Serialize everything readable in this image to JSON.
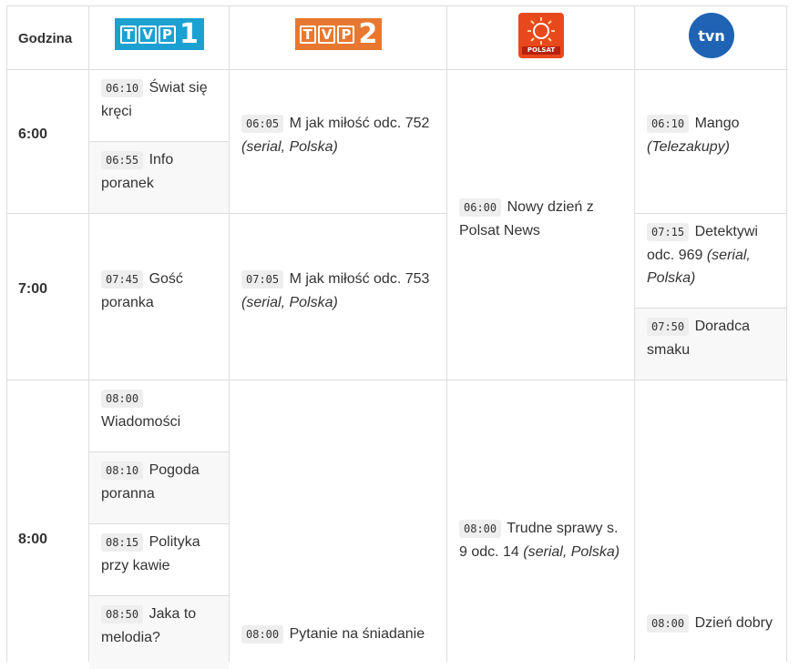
{
  "header": {
    "hour_label": "Godzina",
    "channels": [
      {
        "name": "TVP 1",
        "icon": "tvp1-logo",
        "letters": [
          "T",
          "V",
          "P"
        ],
        "number": "1",
        "color": "#1ba1d1"
      },
      {
        "name": "TVP 2",
        "icon": "tvp2-logo",
        "letters": [
          "T",
          "V",
          "P"
        ],
        "number": "2",
        "color": "#e8782f"
      },
      {
        "name": "POLSAT",
        "icon": "polsat-logo",
        "caption": "POLSAT",
        "color": "#e8491c"
      },
      {
        "name": "tvn",
        "icon": "tvn-logo",
        "caption": "tvn",
        "color": "#1f63b4"
      }
    ]
  },
  "hours": [
    "6:00",
    "7:00",
    "8:00"
  ],
  "programs": {
    "tvp1": [
      {
        "time": "06:10",
        "title": "Świat się kręci"
      },
      {
        "time": "06:55",
        "title": "Info poranek"
      },
      {
        "time": "07:45",
        "title": "Gość poranka"
      },
      {
        "time": "08:00",
        "title": "Wiadomości"
      },
      {
        "time": "08:10",
        "title": "Pogoda poranna"
      },
      {
        "time": "08:15",
        "title": "Polityka przy kawie"
      },
      {
        "time": "08:50",
        "title": "Jaka to melodia?"
      }
    ],
    "tvp2": [
      {
        "time": "06:05",
        "title": "M jak miłość odc. 752",
        "desc": "(serial, Polska)"
      },
      {
        "time": "07:05",
        "title": "M jak miłość odc. 753",
        "desc": "(serial, Polska)"
      },
      {
        "time": "08:00",
        "title": "Pytanie na śniadanie"
      }
    ],
    "polsat": [
      {
        "time": "06:00",
        "title": "Nowy dzień z Polsat News"
      },
      {
        "time": "08:00",
        "title": "Trudne sprawy s. 9 odc. 14",
        "desc": "(serial, Polska)"
      }
    ],
    "tvn": [
      {
        "time": "06:10",
        "title": "Mango",
        "desc": "(Telezakupy)"
      },
      {
        "time": "07:15",
        "title": "Detektywi odc. 969",
        "desc": "(serial, Polska)"
      },
      {
        "time": "07:50",
        "title": "Doradca smaku"
      },
      {
        "time": "08:00",
        "title": "Dzień dobry"
      }
    ]
  }
}
